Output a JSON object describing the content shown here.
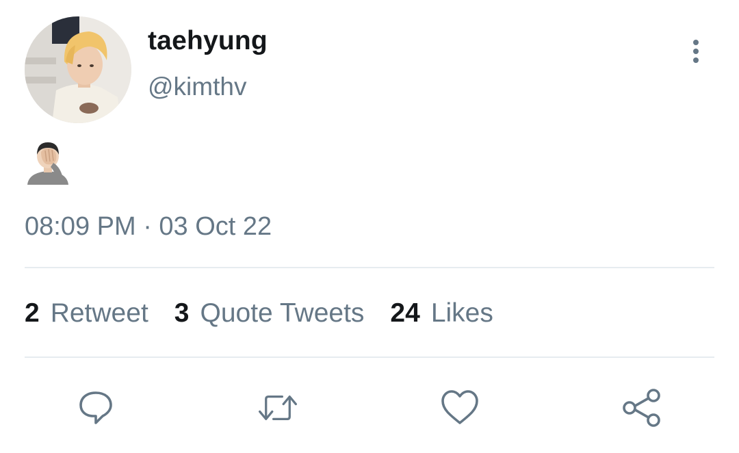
{
  "user": {
    "display_name": "taehyung",
    "handle": "@kimthv"
  },
  "tweet": {
    "content_emoji": "face-palm-emoji",
    "timestamp": "08:09 PM · 03 Oct 22"
  },
  "stats": [
    {
      "count": "2",
      "label": "Retweet"
    },
    {
      "count": "3",
      "label": "Quote Tweets"
    },
    {
      "count": "24",
      "label": "Likes"
    }
  ],
  "actions": {
    "reply": "reply-icon",
    "retweet": "retweet-icon",
    "like": "heart-icon",
    "share": "share-icon"
  },
  "colors": {
    "text_primary": "#14171a",
    "text_secondary": "#657786",
    "divider": "#e6ecf0"
  }
}
